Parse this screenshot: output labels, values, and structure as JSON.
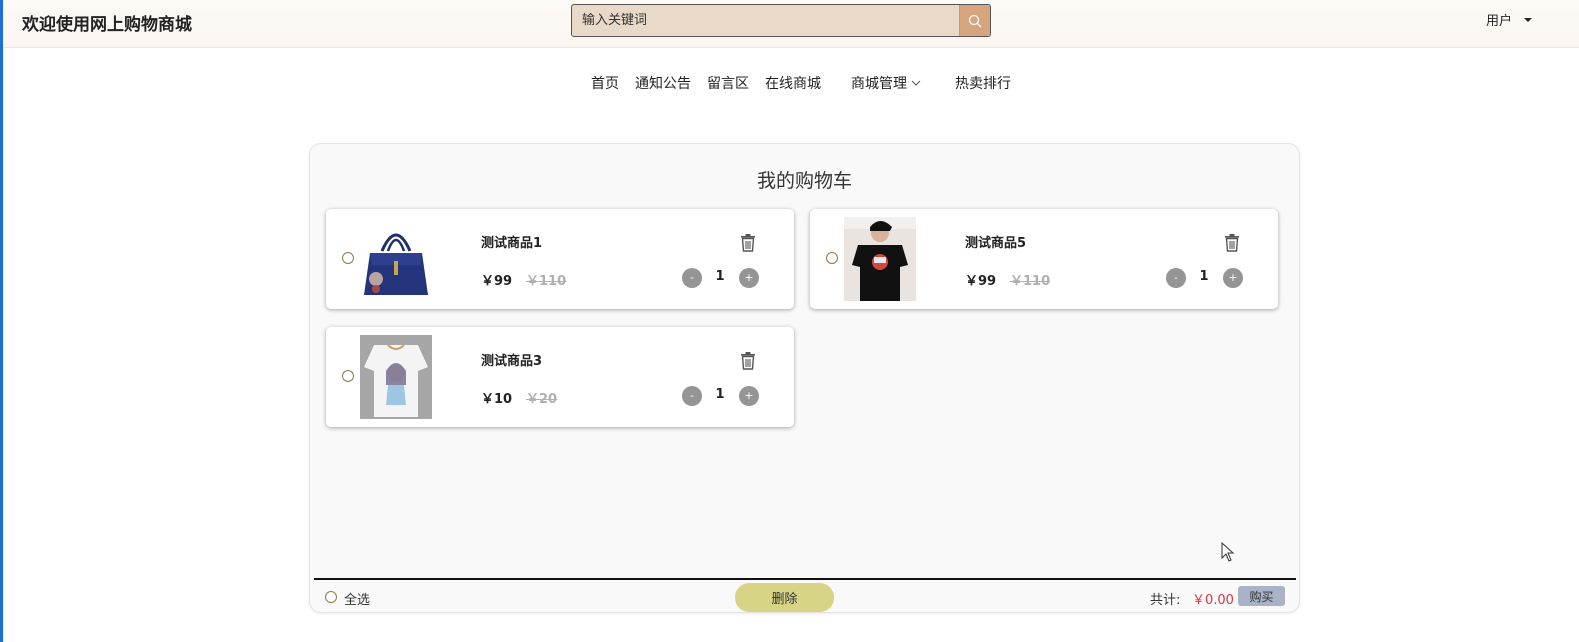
{
  "header": {
    "site_title": "欢迎使用网上购物商城",
    "search_placeholder": "输入关键词",
    "user_label": "用户"
  },
  "nav": {
    "items": [
      "首页",
      "通知公告",
      "留言区",
      "在线商城",
      "商城管理",
      "热卖排行"
    ]
  },
  "cart": {
    "title": "我的购物车",
    "items": [
      {
        "name": "测试商品1",
        "price": "￥99",
        "old_price": "￥110",
        "qty": "1",
        "image": "handbag-image"
      },
      {
        "name": "测试商品5",
        "price": "￥99",
        "old_price": "￥110",
        "qty": "1",
        "image": "black-tshirt-image"
      },
      {
        "name": "测试商品3",
        "price": "￥10",
        "old_price": "￥20",
        "qty": "1",
        "image": "white-tshirt-image"
      }
    ],
    "minus_label": "-",
    "plus_label": "+",
    "select_all": "全选",
    "delete_label": "删除",
    "total_label": "共计:",
    "total_value": "￥0.00",
    "buy_label": "购买"
  },
  "colors": {
    "accent_search": "#d6a57d",
    "delete_button": "#d8d486",
    "buy_button": "#a9b2c7",
    "total_price": "#d9363e"
  }
}
